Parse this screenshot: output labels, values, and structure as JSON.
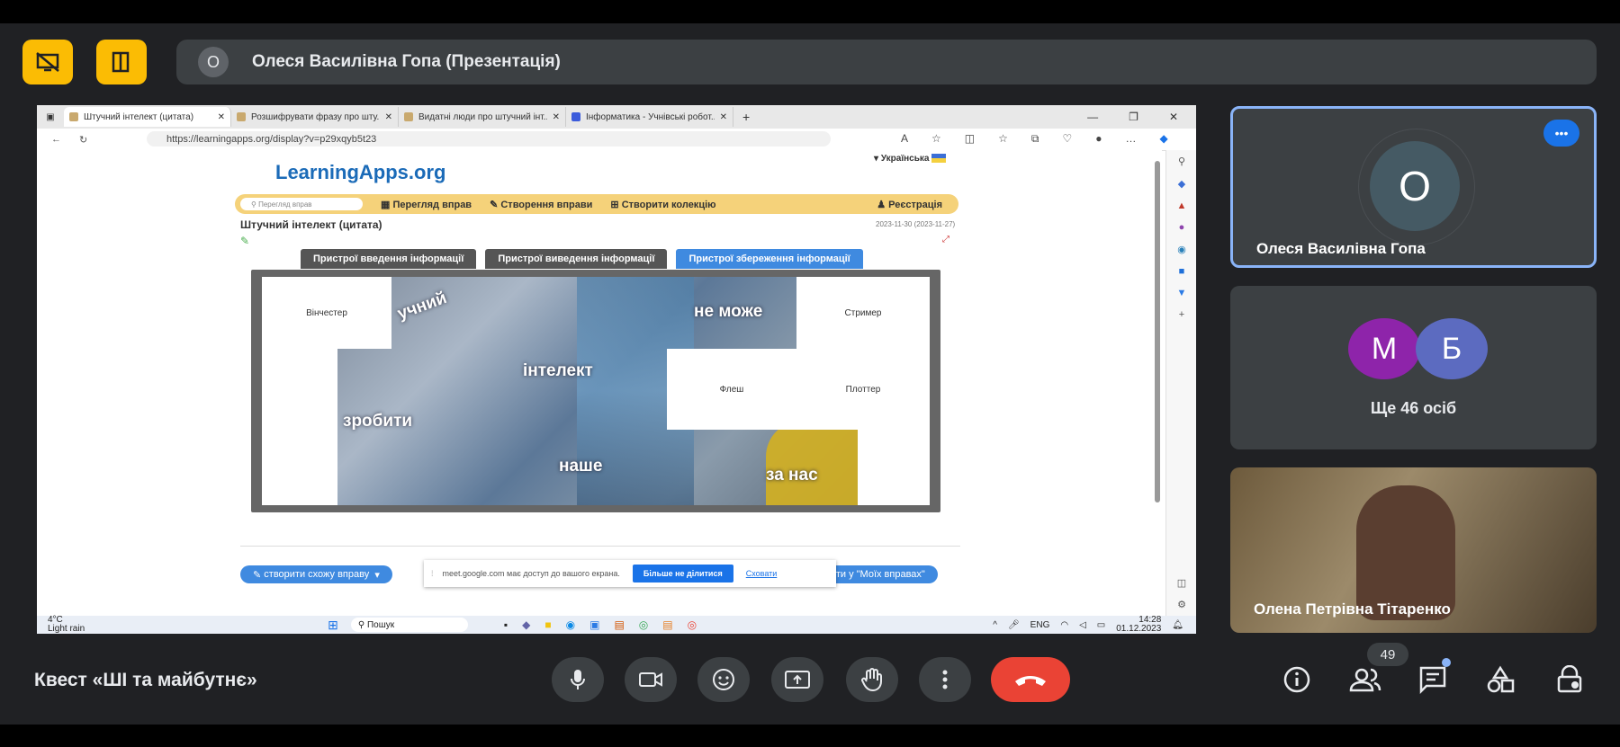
{
  "presentation": {
    "avatar_letter": "О",
    "title": "Олеся Василівна Гопа (Презентація)"
  },
  "browser": {
    "tabs": [
      "Штучний інтелект (цитата)",
      "Розшифрувати фразу про шту...",
      "Видатні люди про штучний інт...",
      "Інформатика - Учнівські робот..."
    ],
    "url": "https://learningapps.org/display?v=p29xqyb5t23"
  },
  "app": {
    "logo": "LearningApps.org",
    "language": "Українська",
    "search_placeholder": "Перегляд вправ",
    "nav": [
      "Перегляд вправ",
      "Створення вправи",
      "Створити колекцію"
    ],
    "register": "Реєстрація",
    "title": "Штучний інтелект (цитата)",
    "date": "2023-11-30",
    "date_note": "(2023-11-27)",
    "categories": [
      "Пристрої введення інформації",
      "Пристрої виведення інформації",
      "Пристрої збереження інформації"
    ],
    "pieces": [
      "Вінчестер",
      "Стример",
      "Флеш",
      "Плоттер"
    ],
    "image_words": [
      "учний",
      "не може",
      "інтелект",
      "зробити",
      "наше",
      "за нас"
    ],
    "create_similar": "створити схожу вправу",
    "save_mine": "закласти у \"Моїх вправах\""
  },
  "share_notice": {
    "text": "meet.google.com має доступ до вашого екрана.",
    "stop": "Більше не ділитися",
    "hide": "Сховати"
  },
  "taskbar": {
    "temp": "4°C",
    "weather": "Light rain",
    "search": "Пошук",
    "lang": "ENG",
    "time": "14:28",
    "date": "01.12.2023"
  },
  "participants": {
    "speaker": {
      "letter": "О",
      "name": "Олеся Василівна Гопа"
    },
    "group": {
      "letters": [
        "М",
        "Б"
      ],
      "label": "Ще 46 осіб"
    },
    "video": {
      "name": "Олена Петрівна Тітаренко"
    }
  },
  "meeting": {
    "title": "Квест «ШІ та майбутнє»",
    "count": "49"
  },
  "colors": {
    "bg": "#202124",
    "tile": "#3c4043",
    "accent": "#fbbc04",
    "end_call": "#ea4335",
    "avatar_m": "#8e24aa",
    "avatar_b": "#5c6bc0",
    "speaker_border": "#8ab4f8"
  }
}
